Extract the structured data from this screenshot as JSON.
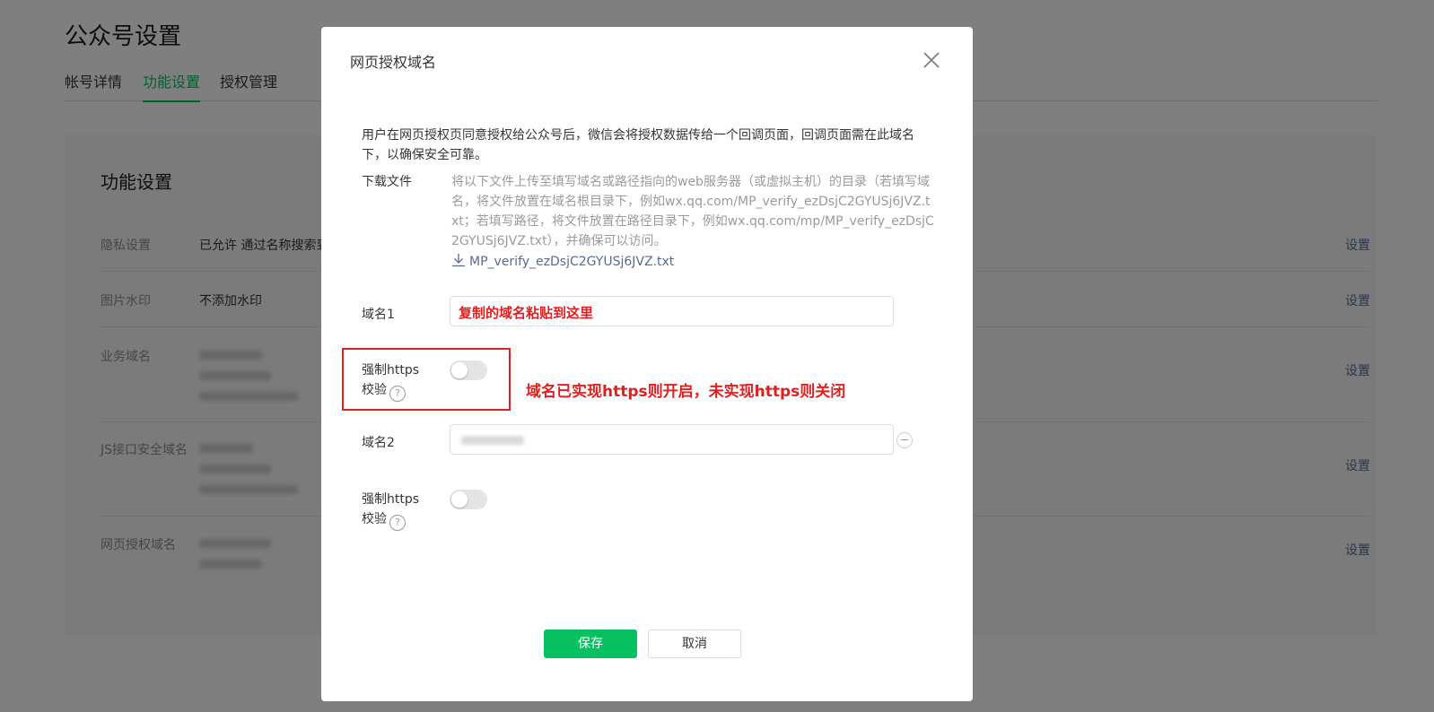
{
  "page": {
    "title": "公众号设置",
    "tabs": [
      "帐号详情",
      "功能设置",
      "授权管理"
    ],
    "active_tab": "功能设置",
    "section_title": "功能设置",
    "settings": [
      {
        "label": "隐私设置",
        "value": "已允许 通过名称搜索到本帐号",
        "action": "设置"
      },
      {
        "label": "图片水印",
        "value": "不添加水印",
        "action": "设置"
      },
      {
        "label": "业务域名",
        "value": "",
        "action": "设置"
      },
      {
        "label": "JS接口安全域名",
        "value": "",
        "action": "设置"
      },
      {
        "label": "网页授权域名",
        "value": "",
        "action": "设置"
      }
    ]
  },
  "dialog": {
    "title": "网页授权域名",
    "description": "用户在网页授权页同意授权给公众号后，微信会将授权数据传给一个回调页面，回调页面需在此域名下，以确保安全可靠。",
    "download_label": "下载文件",
    "download_text": "将以下文件上传至填写域名或路径指向的web服务器（或虚拟主机）的目录（若填写域名，将文件放置在域名根目录下，例如wx.qq.com/MP_verify_ezDsjC2GYUSj6JVZ.txt；若填写路径，将文件放置在路径目录下，例如wx.qq.com/mp/MP_verify_ezDsjC2GYUSj6JVZ.txt），并确保可以访问。",
    "download_file": "MP_verify_ezDsjC2GYUSj6JVZ.txt",
    "domain1_label": "域名1",
    "domain1_value": "复制的域名粘贴到这里",
    "https_label_line1": "强制https",
    "https_label_line2": "校验",
    "https1_enabled": false,
    "domain2_label": "域名2",
    "https2_enabled": false,
    "annotation": "域名已实现https则开启，未实现https则关闭",
    "save_label": "保存",
    "cancel_label": "取消"
  },
  "icons": [
    "close-icon",
    "download-icon",
    "help-icon",
    "remove-icon"
  ],
  "colors": {
    "accent": "#07c160",
    "link": "#576b95",
    "annotation": "#e02020"
  }
}
